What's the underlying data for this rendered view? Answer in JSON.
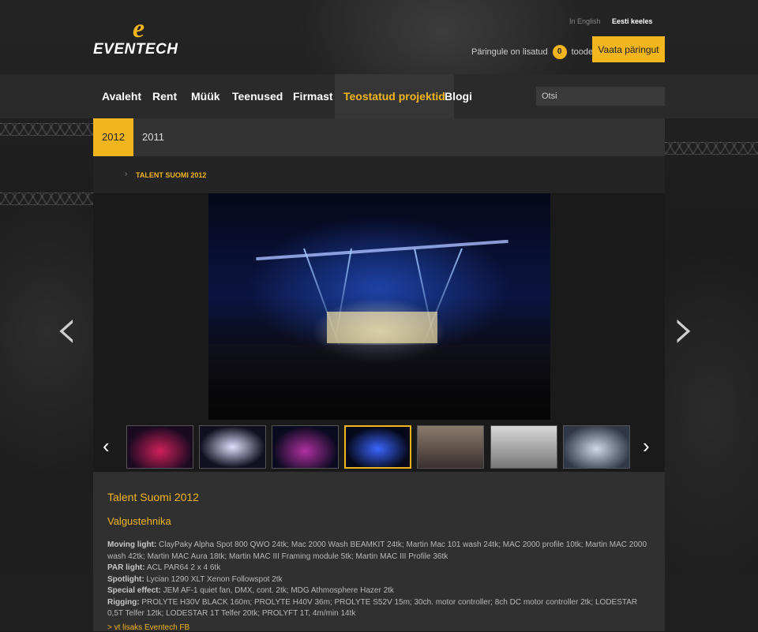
{
  "header": {
    "logo_text": "EVENTECH",
    "lang_en": "In English",
    "lang_et": "Eesti keeles",
    "cart_prefix": "Päringule on lisatud",
    "cart_count": "0",
    "cart_suffix": "toodet",
    "cart_button": "Vaata päringut"
  },
  "nav": {
    "items": [
      "Avaleht",
      "Rent",
      "Müük",
      "Teenused",
      "Firmast",
      "Teostatud projektid",
      "Blogi"
    ],
    "active": "Teostatud projektid",
    "search_placeholder": "Otsi"
  },
  "years": [
    "2012",
    "2011"
  ],
  "breadcrumb": "TALENT SUOMI 2012",
  "gallery": {
    "thumb_count": 7,
    "active_thumb": 4
  },
  "details": {
    "title": "Talent Suomi 2012",
    "subtitle": "Valgustehnika",
    "rows": [
      {
        "label": "Moving light:",
        "text": " ClayPaky Alpha Spot 800 QWO  24tk; Mac 2000 Wash BEAMKIT  24tk; Martin Mac 101 wash  24tk; MAC 2000 profile  10tk; Martin MAC 2000 wash  42tk; Martin MAC Aura  18tk; Martin MAC III Framing module  5tk; Martin MAC III Profile  36tk"
      },
      {
        "label": "PAR light:",
        "text": " ACL PAR64 2 x 4  6tk"
      },
      {
        "label": "Spotlight:",
        "text": " Lycian 1290 XLT Xenon Followspot  2tk"
      },
      {
        "label": "Special effect:",
        "text": " JEM AF-1 quiet fan, DMX, cont.  2tk; MDG Athmosphere Hazer  2tk"
      },
      {
        "label": "Rigging:",
        "text": " PROLYTE H30V BLACK  160m; PROLYTE H40V  36m; PROLYTE S52V  15m; 30ch. motor controller; 8ch DC motor controller  2tk; LODESTAR 0,5T Telfer  12tk; LODESTAR 1T Telfer  20tk; PROLYFT 1T, 4m/min  14tk"
      }
    ],
    "more_link": "> vt lisaks Eventech FB"
  },
  "colors": {
    "accent": "#f2b51c",
    "nav_bg": "#2a2a2a",
    "content_bg": "#2b2b2b"
  },
  "icons": {
    "prev": "chevron-left-icon",
    "next": "chevron-right-icon"
  }
}
